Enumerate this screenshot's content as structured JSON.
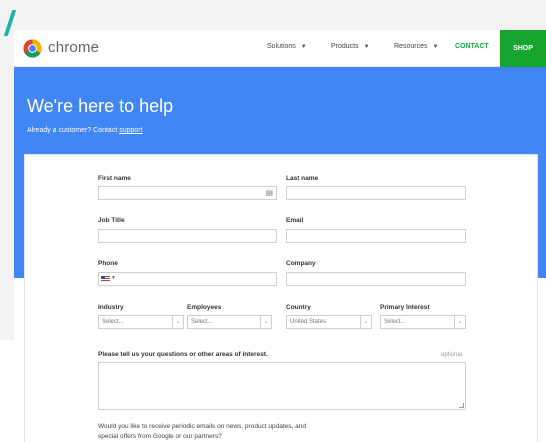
{
  "header": {
    "brand": "chrome",
    "nav": [
      {
        "label": "Solutions"
      },
      {
        "label": "Products"
      },
      {
        "label": "Resources"
      }
    ],
    "contact_label": "CONTACT",
    "shop_label": "SHOP"
  },
  "hero": {
    "title": "We're here to help",
    "subtitle_prefix": "Already a customer? Contact ",
    "subtitle_link": "support"
  },
  "form": {
    "first_name": {
      "label": "First name",
      "value": ""
    },
    "last_name": {
      "label": "Last name",
      "value": ""
    },
    "job_title": {
      "label": "Job Title",
      "value": ""
    },
    "email": {
      "label": "Email",
      "value": ""
    },
    "phone": {
      "label": "Phone",
      "value": ""
    },
    "company": {
      "label": "Company",
      "value": ""
    },
    "industry": {
      "label": "Industry",
      "selected": "Select..."
    },
    "employees": {
      "label": "Employees",
      "selected": "Select..."
    },
    "country": {
      "label": "Country",
      "selected": "United States"
    },
    "primary_interest": {
      "label": "Primary Interest",
      "selected": "Select..."
    },
    "questions": {
      "label": "Please tell us your questions or other areas of interest.",
      "optional": "optional",
      "value": ""
    },
    "newsletter_prompt": "Would you like to receive periodic emails on news, product updates, and special offers from Google or our partners?"
  },
  "colors": {
    "hero_blue": "#4285f4",
    "shop_green": "#17a52f",
    "contact_green": "#16a34a"
  }
}
